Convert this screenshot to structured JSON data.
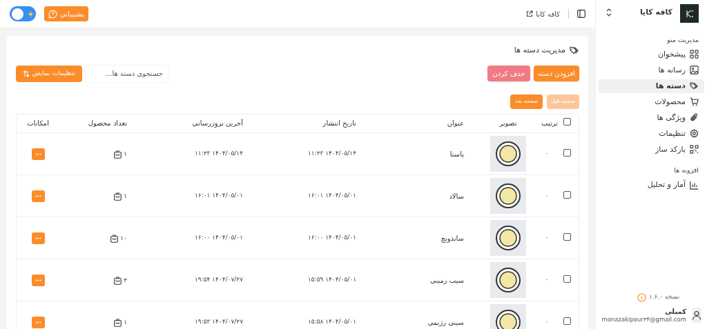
{
  "sidebar": {
    "brand": {
      "name": "کافه کایا"
    },
    "sections": [
      {
        "title": "مدیریت منو",
        "items": [
          {
            "label": "پیشخوان",
            "selected": false
          },
          {
            "label": "رسانه ها",
            "selected": false
          },
          {
            "label": "دسته ها",
            "selected": true
          },
          {
            "label": "محصولات",
            "selected": false
          },
          {
            "label": "ویژگی ها",
            "selected": false
          },
          {
            "label": "تنظیمات",
            "selected": false
          },
          {
            "label": "بارکد ساز",
            "selected": false
          }
        ]
      },
      {
        "title": "افزونه ها",
        "items": [
          {
            "label": "آمار و تحلیل",
            "selected": false
          }
        ]
      }
    ],
    "version": "نسخه ۱.۶.۰",
    "user": {
      "name": "کمیلی",
      "email": "monazakipour۳۴@gmail.com"
    }
  },
  "topbar": {
    "shop_link": "کافه کایا",
    "support_button": "پشتیبانی",
    "theme_toggle": {
      "dark_mode": false
    }
  },
  "page": {
    "title": "مدیریت دسته ها",
    "actions": [
      {
        "label": "افزودن دسته",
        "kind": "primary"
      },
      {
        "label": "حذف کردن",
        "kind": "danger"
      }
    ],
    "search": {
      "placeholder": "جستجوی دسته ها..."
    },
    "display_settings": "تنظیمات نمایش",
    "pagination": [
      {
        "label": "صفحه قبل",
        "disabled": true
      },
      {
        "label": "صفحه بعد",
        "disabled": false
      }
    ],
    "table": {
      "header_checked": false,
      "columns": [
        "ترتیب",
        "تصویر",
        "عنوان",
        "تاریخ انتشار",
        "آخرین بروزرسانی",
        "تعداد محصول",
        "امکانات"
      ],
      "rows": [
        {
          "checked": false,
          "order": "۰",
          "title": "پاستا",
          "published": "۱۴۰۴/۰۵/۱۴ ۱۱:۲۳",
          "updated": "۱۴۰۴/۰۵/۱۴ ۱۱:۲۳",
          "count": "۱"
        },
        {
          "checked": false,
          "order": "۰",
          "title": "سالاد",
          "published": "۱۴۰۴/۰۵/۰۱ ۱۶:۰۱",
          "updated": "۱۴۰۴/۰۵/۰۱ ۱۶:۰۱",
          "count": "۱"
        },
        {
          "checked": false,
          "order": "۰",
          "title": "ساندویچ",
          "published": "۱۴۰۴/۰۵/۰۱ ۱۶:۰۰",
          "updated": "۱۴۰۴/۰۵/۰۱ ۱۶:۰۰",
          "count": "۱۰"
        },
        {
          "checked": false,
          "order": "۰",
          "title": "سیب زمینی",
          "published": "۱۴۰۴/۰۵/۰۱ ۱۵:۵۹",
          "updated": "۱۴۰۴/۰۷/۲۷ ۱۹:۵۴",
          "count": "۲"
        },
        {
          "checked": false,
          "order": "۰",
          "title": "سینی رژیمی",
          "published": "۱۴۰۴/۰۵/۰۱ ۱۵:۵۸",
          "updated": "۱۴۰۴/۰۷/۲۷ ۱۹:۵۳",
          "count": "۱"
        }
      ]
    }
  }
}
